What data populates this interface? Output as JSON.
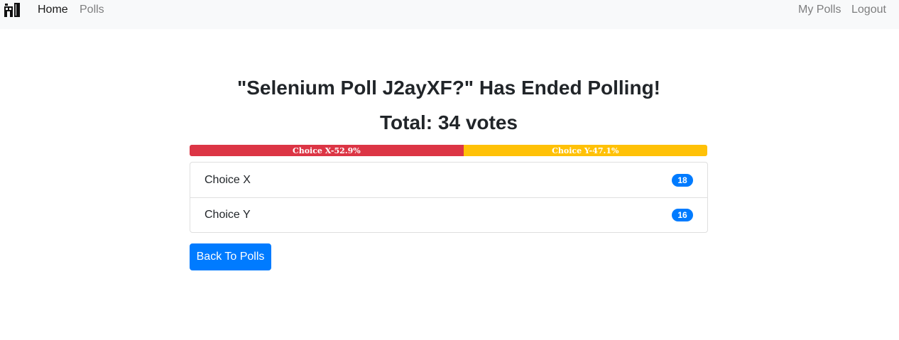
{
  "nav": {
    "brand_icon": "ballot-box-icon",
    "home": "Home",
    "polls": "Polls",
    "my_polls": "My Polls",
    "logout": "Logout"
  },
  "poll": {
    "title": "\"Selenium Poll J2ayXF?\" Has Ended Polling!",
    "total": "Total: 34 votes",
    "results": [
      {
        "label": "Choice X",
        "votes": "18",
        "bar_label": "Choice X-52.9%",
        "percent": 52.9,
        "color": "#dc3545"
      },
      {
        "label": "Choice Y",
        "votes": "16",
        "bar_label": "Choice Y-47.1%",
        "percent": 47.1,
        "color": "#ffc107"
      }
    ]
  },
  "actions": {
    "back": "Back To Polls"
  },
  "colors": {
    "primary": "#007bff",
    "navbar_bg": "#f8f9fa"
  }
}
